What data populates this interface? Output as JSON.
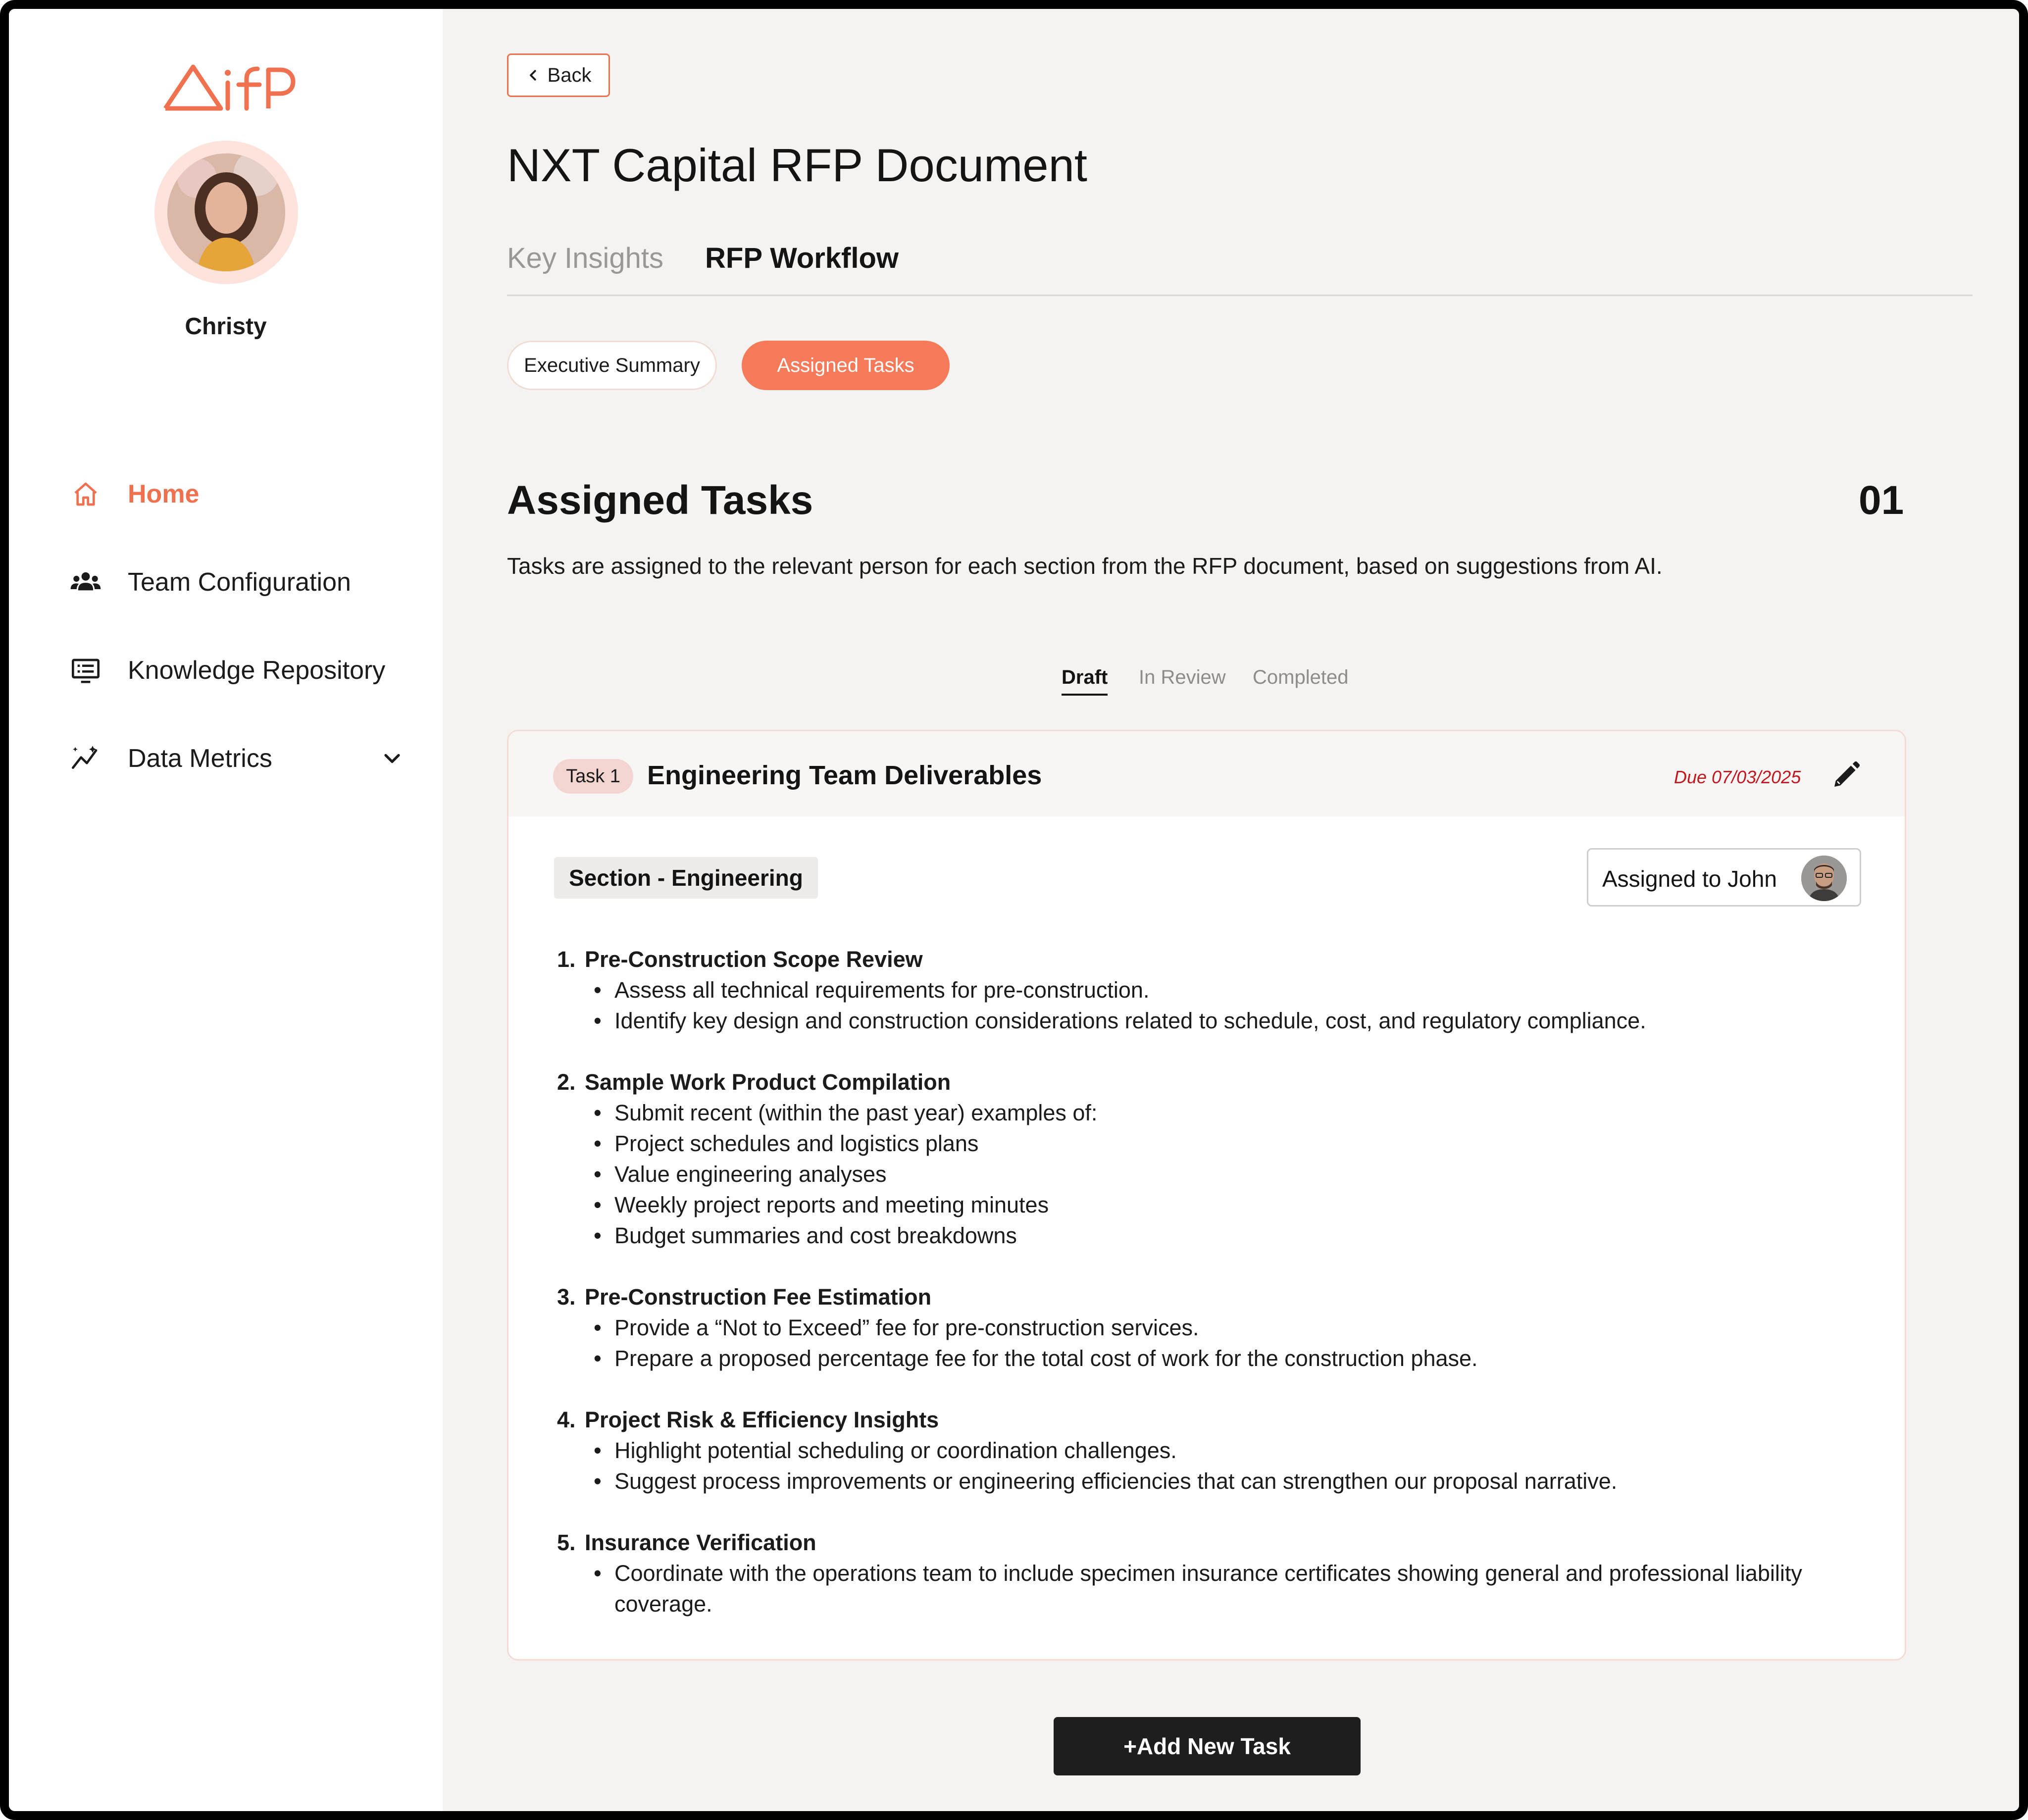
{
  "brand": {
    "logo_text": "ifP",
    "accent": "#f0714f"
  },
  "user": {
    "name": "Christy"
  },
  "nav": [
    {
      "label": "Home",
      "icon": "home-icon",
      "active": true
    },
    {
      "label": "Team Configuration",
      "icon": "team-icon",
      "active": false
    },
    {
      "label": "Knowledge Repository",
      "icon": "repository-icon",
      "active": false
    },
    {
      "label": "Data Metrics",
      "icon": "metrics-icon",
      "active": false
    }
  ],
  "header": {
    "back_label": "Back",
    "title": "NXT Capital RFP Document",
    "tabs": [
      "Key Insights",
      "RFP Workflow"
    ],
    "active_tab": "RFP Workflow"
  },
  "subtabs": [
    "Executive Summary",
    "Assigned Tasks"
  ],
  "section": {
    "title": "Assigned Tasks",
    "count": "01",
    "description": "Tasks are assigned to the relevant person for each section from the RFP document, based on suggestions from AI."
  },
  "status_tabs": [
    "Draft",
    "In Review",
    "Completed"
  ],
  "task": {
    "badge": "Task 1",
    "title": "Engineering Team Deliverables",
    "due": "Due 07/03/2025",
    "section_tag": "Section  - Engineering",
    "assigned_label": "Assigned to John",
    "groups": [
      {
        "num": "1.",
        "title": "Pre-Construction Scope Review",
        "items": [
          "Assess all technical requirements for pre-construction.",
          "Identify key design and construction considerations related to schedule, cost, and regulatory compliance."
        ]
      },
      {
        "num": "2.",
        "title": "Sample Work Product Compilation",
        "items": [
          "Submit recent (within the past year) examples of:",
          "Project schedules and logistics plans",
          "Value engineering analyses",
          "Weekly project reports and meeting minutes",
          "Budget summaries and cost breakdowns"
        ]
      },
      {
        "num": "3.",
        "title": "Pre-Construction Fee Estimation",
        "items": [
          "Provide a “Not to Exceed” fee for pre-construction services.",
          "Prepare a proposed percentage fee for the total cost of work for the construction phase."
        ]
      },
      {
        "num": "4.",
        "title": "Project Risk & Efficiency Insights",
        "items": [
          "Highlight potential scheduling or coordination challenges.",
          "Suggest process improvements or engineering efficiencies that can strengthen our proposal narrative."
        ]
      },
      {
        "num": "5.",
        "title": "Insurance Verification",
        "items": [
          "Coordinate with the operations team to include specimen insurance certificates showing general and professional liability coverage."
        ]
      }
    ]
  },
  "add_task_label": "+Add New Task"
}
